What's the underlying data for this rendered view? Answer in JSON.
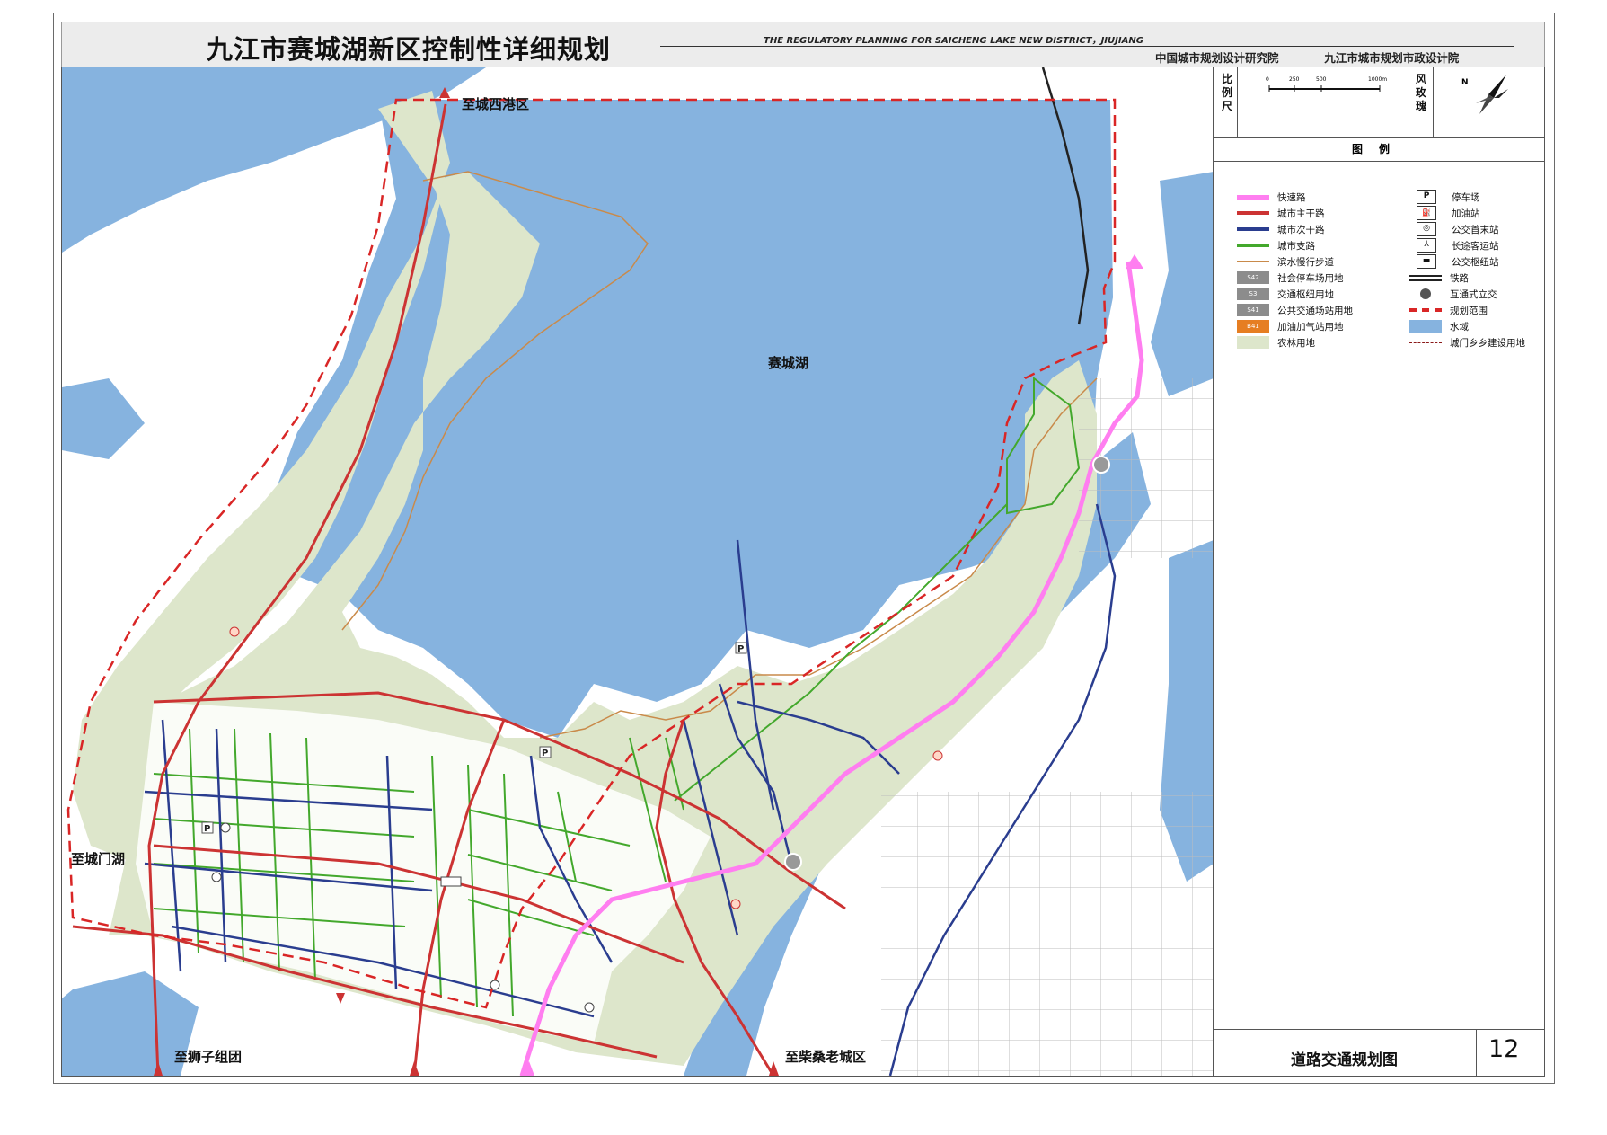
{
  "header": {
    "title_cn": "九江市赛城湖新区控制性详细规划",
    "title_en": "THE REGULATORY PLANNING FOR SAICHENG LAKE NEW DISTRICT，JIUJIANG",
    "institute_1": "中国城市规划设计研究院",
    "institute_2": "九江市城市规划市政设计院"
  },
  "map": {
    "lake_name": "赛城湖",
    "places": {
      "north": "至城西港区",
      "west": "至城门湖",
      "south_west": "至狮子组团",
      "south": "至柴桑老城区"
    },
    "colors": {
      "water": "#86b3df",
      "farmland": "#dde6cb",
      "expressway": "#ff7ef0",
      "main_road": "#cc3333",
      "secondary_road": "#2a3d8f",
      "branch_road": "#43a82c",
      "waterfront_path": "#c98a4a",
      "boundary": "#d92626"
    }
  },
  "sidebar": {
    "scale_label": "比例尺",
    "scale_ticks": [
      "0",
      "250",
      "500",
      "1000m"
    ],
    "wind_label": "风玫瑰",
    "north_label": "N",
    "legend_title": "图例",
    "legend_left": [
      {
        "label": "快速路",
        "icon": "expressway-line"
      },
      {
        "label": "城市主干路",
        "icon": "main-road-line"
      },
      {
        "label": "城市次干路",
        "icon": "secondary-road-line"
      },
      {
        "label": "城市支路",
        "icon": "branch-road-line"
      },
      {
        "label": "滨水慢行步道",
        "icon": "waterfront-path-line"
      },
      {
        "label": "社会停车场用地",
        "code": "S42",
        "icon": "parking-land-swatch"
      },
      {
        "label": "交通枢纽用地",
        "code": "S3",
        "icon": "hub-land-swatch"
      },
      {
        "label": "公共交通场站用地",
        "code": "S41",
        "icon": "transit-land-swatch"
      },
      {
        "label": "加油加气站用地",
        "code": "B41",
        "icon": "gas-land-swatch"
      },
      {
        "label": "农林用地",
        "icon": "farmland-swatch"
      }
    ],
    "legend_right": [
      {
        "label": "停车场",
        "icon": "parking-icon",
        "glyph": "P"
      },
      {
        "label": "加油站",
        "icon": "gas-station-icon",
        "glyph": "⛽"
      },
      {
        "label": "公交首末站",
        "icon": "bus-terminal-icon",
        "glyph": "◎"
      },
      {
        "label": "长途客运站",
        "icon": "coach-station-icon",
        "glyph": "⅄"
      },
      {
        "label": "公交枢纽站",
        "icon": "bus-hub-icon",
        "glyph": "▬"
      },
      {
        "label": "铁路",
        "icon": "railway-line"
      },
      {
        "label": "互通式立交",
        "icon": "interchange-icon"
      },
      {
        "label": "规划范围",
        "icon": "planning-boundary-line"
      },
      {
        "label": "水域",
        "icon": "water-swatch"
      },
      {
        "label": "城门乡乡建设用地",
        "icon": "township-boundary-line"
      }
    ],
    "drawing_name": "道路交通规划图",
    "page_number": "12"
  }
}
